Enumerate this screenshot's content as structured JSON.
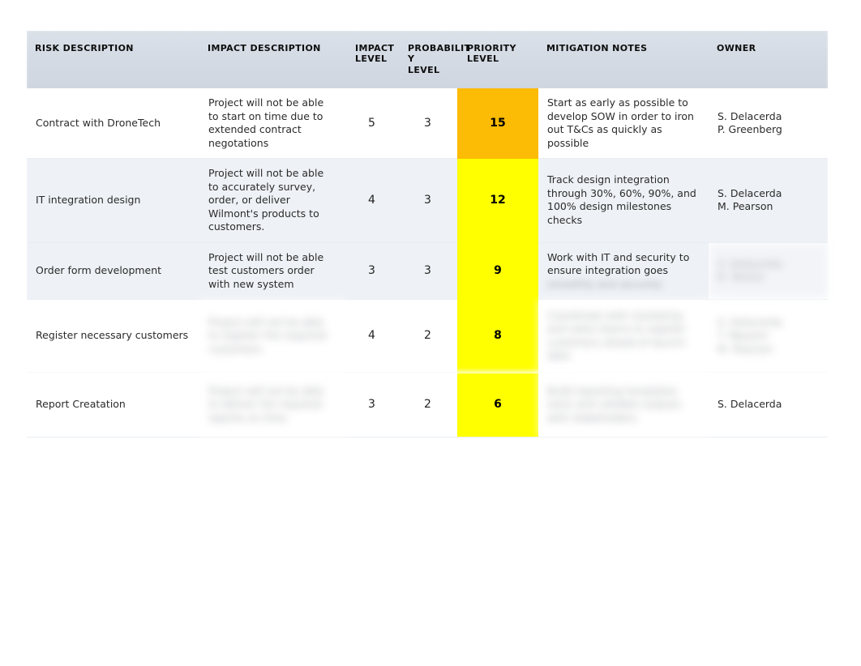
{
  "table": {
    "name": "risk-register",
    "columns": [
      {
        "key": "risk_description",
        "label": "RISK DESCRIPTION"
      },
      {
        "key": "impact_description",
        "label": "IMPACT DESCRIPTION"
      },
      {
        "key": "impact_level",
        "label": "IMPACT LEVEL"
      },
      {
        "key": "probability_level",
        "label": "PROBABILITY LEVEL"
      },
      {
        "key": "priority_level",
        "label": "PRIORITY LEVEL"
      },
      {
        "key": "mitigation_notes",
        "label": "MITIGATION NOTES"
      },
      {
        "key": "owner",
        "label": "OWNER"
      }
    ],
    "column_label_wraps": {
      "impact_level": [
        "IMPACT",
        "LEVEL"
      ],
      "probability_level": [
        "PROBABILIT",
        "Y LEVEL"
      ],
      "priority_level": [
        "PRIORITY",
        "LEVEL"
      ]
    },
    "rows": [
      {
        "risk_description": "Contract with DroneTech",
        "impact_description": "Project will not be able to start on time due to extended contract negotations",
        "impact_level": "5",
        "probability_level": "3",
        "priority_level": "15",
        "priority_color": "#fcbb04",
        "mitigation_notes": "Start as early as possible to develop SOW in order to iron out T&Cs as quickly as possible",
        "owner_lines": [
          "S. Delacerda",
          "P. Greenberg"
        ],
        "shaded": false,
        "redacted": {
          "impact_description": false,
          "mitigation_notes": false,
          "owner": false
        }
      },
      {
        "risk_description": "IT integration design",
        "impact_description": "Project will not be able to accurately survey, order, or deliver Wilmont's products to customers.",
        "impact_level": "4",
        "probability_level": "3",
        "priority_level": "12",
        "priority_color": "#ffff00",
        "mitigation_notes": "Track design integration through 30%, 60%, 90%, and 100% design milestones checks",
        "owner_lines": [
          "S. Delacerda",
          "M. Pearson"
        ],
        "shaded": true,
        "redacted": {
          "impact_description": false,
          "mitigation_notes": false,
          "owner": false
        }
      },
      {
        "risk_description": "Order form development",
        "impact_description": "Project will not be able test customers order with new system",
        "impact_level": "3",
        "probability_level": "3",
        "priority_level": "9",
        "priority_color": "#ffff00",
        "mitigation_notes": "Work with IT and security to ensure integration goes smoothly and securely",
        "owner_lines": [
          "S. Delacerda",
          "R. Tamiro"
        ],
        "shaded": true,
        "redacted": {
          "impact_description": false,
          "mitigation_notes": "partial",
          "owner": true
        }
      },
      {
        "risk_description": "Register necessary customers",
        "impact_description": "Project will not be able to register the required customers",
        "impact_level": "4",
        "probability_level": "2",
        "priority_level": "8",
        "priority_color": "#ffff00",
        "mitigation_notes": "Coordinate with marketing and sales teams to register customers ahead of launch date",
        "owner_lines": [
          "S. Delacerda",
          "T. Nguyen",
          "M. Pearson"
        ],
        "shaded": false,
        "redacted": {
          "impact_description": true,
          "mitigation_notes": true,
          "owner": true
        }
      },
      {
        "risk_description": "Report Creatation",
        "impact_description": "Project will not be able to deliver the required reports on time",
        "impact_level": "3",
        "probability_level": "2",
        "priority_level": "6",
        "priority_color": "#ffff00",
        "mitigation_notes": "Build reporting templates early and validate outputs with stakeholders",
        "owner_lines": [
          "S. Delacerda"
        ],
        "shaded": false,
        "redacted": {
          "impact_description": true,
          "mitigation_notes": true,
          "owner": false
        }
      }
    ]
  },
  "colors": {
    "header_background": "#d3dae3",
    "row_shaded": "#eef1f5",
    "row_plain": "#ffffff",
    "priority_high": "#fcbb04",
    "priority_medium": "#ffff00",
    "grid_line": "#e9edf2",
    "text": "#2b2b2b"
  }
}
